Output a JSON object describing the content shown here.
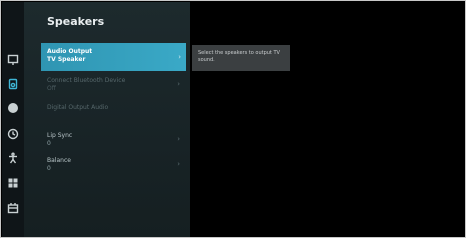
{
  "screen": {
    "title": "Speakers"
  },
  "sidebar": {
    "icons": [
      {
        "name": "monitor-icon",
        "active": false
      },
      {
        "name": "speaker-icon",
        "active": true
      },
      {
        "name": "globe-icon",
        "active": false
      },
      {
        "name": "clock-icon",
        "active": false
      },
      {
        "name": "accessibility-icon",
        "active": false
      },
      {
        "name": "apps-grid-icon",
        "active": false
      },
      {
        "name": "support-icon",
        "active": false
      }
    ]
  },
  "menu": {
    "items": [
      {
        "line1": "Audio Output",
        "line2": "TV Speaker",
        "state": "selected"
      },
      {
        "line1": "Connect Bluetooth Device",
        "line2": "Off",
        "state": "disabled"
      },
      {
        "line1": "Digital Output Audio",
        "line2": "",
        "state": "disabled"
      },
      {
        "line1": "Lip Sync",
        "line2": "0",
        "state": "normal"
      },
      {
        "line1": "Balance",
        "line2": "0",
        "state": "normal"
      }
    ]
  },
  "tooltip": {
    "text": "Select the speakers to output TV sound."
  },
  "colors": {
    "accent": "#3aa9c7",
    "menu_bg": "#1c2a2c",
    "tooltip_bg": "#3b3f41"
  }
}
